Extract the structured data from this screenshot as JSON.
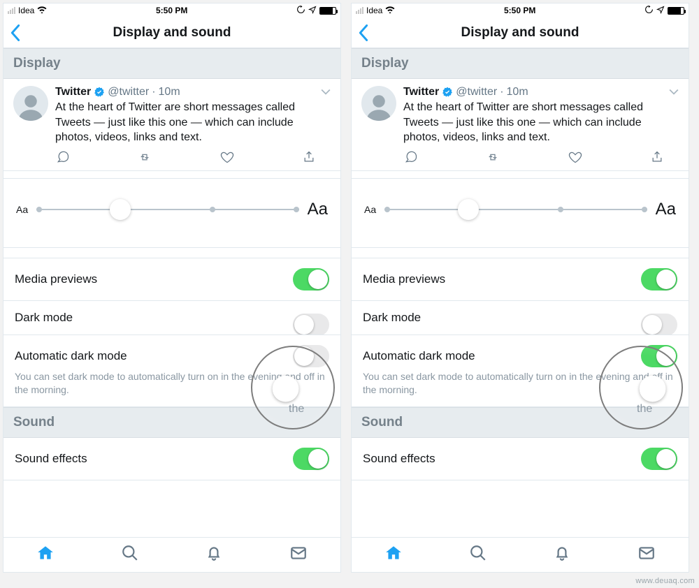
{
  "statusbar": {
    "carrier": "Idea",
    "time": "5:50 PM"
  },
  "nav": {
    "title": "Display and sound"
  },
  "sections": {
    "display": "Display",
    "sound": "Sound"
  },
  "tweet": {
    "name": "Twitter",
    "handle": "@twitter",
    "sep": "·",
    "time": "10m",
    "text": "At the heart of Twitter are short messages called Tweets — just like this one — which can include photos, videos, links and text."
  },
  "textsize": {
    "small": "Aa",
    "large": "Aa"
  },
  "rows": {
    "media_previews": "Media previews",
    "dark_mode": "Dark mode",
    "auto_dark": "Automatic dark mode",
    "auto_dark_desc": "You can set dark mode to automatically turn on in the evening and off in the morning.",
    "sound_effects": "Sound effects"
  },
  "toggles": {
    "left": {
      "media_previews": true,
      "dark_mode_partial": true,
      "auto_dark": false,
      "sound_effects": true
    },
    "right": {
      "media_previews": true,
      "dark_mode_partial": true,
      "auto_dark": true,
      "sound_effects": true
    }
  },
  "circle_text": "the",
  "watermark": "www.deuaq.com"
}
